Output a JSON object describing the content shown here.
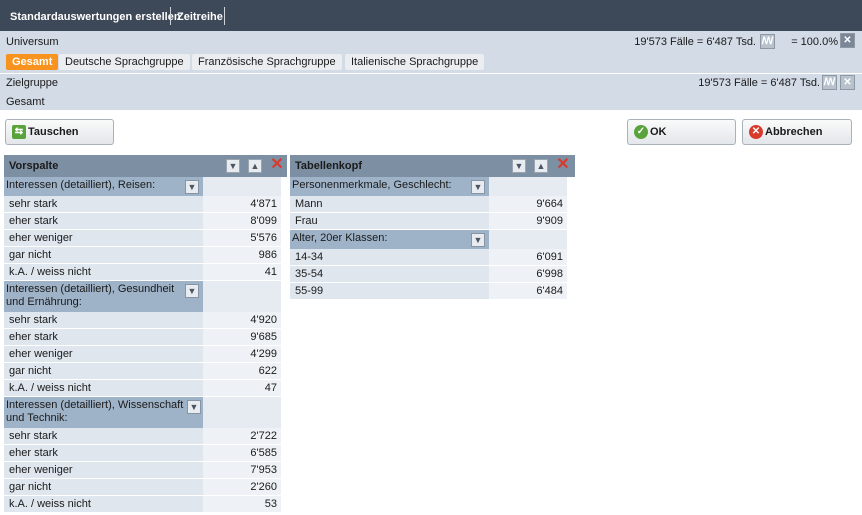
{
  "toolbar": {
    "tab1": "Standardauswertungen erstellen",
    "tab2": "Zeitreihe"
  },
  "universe": {
    "label": "Universum",
    "count": "19'573 Fälle = 6'487 Tsd.",
    "percent": "= 100.0%",
    "tabs": [
      "Gesamt",
      "Deutsche Sprachgruppe",
      "Französische Sprachgruppe",
      "Italienische Sprachgruppe"
    ],
    "active_tab": "Gesamt"
  },
  "target": {
    "label": "Zielgruppe",
    "count": "19'573 Fälle = 6'487 Tsd.",
    "value": "Gesamt"
  },
  "buttons": {
    "swap": "Tauschen",
    "ok": "OK",
    "cancel": "Abbrechen"
  },
  "vorspalte": {
    "title": "Vorspalte",
    "groups": [
      {
        "title": "Interessen (detailliert), Reisen:",
        "rows": [
          {
            "label": "sehr stark",
            "value": "4'871"
          },
          {
            "label": "eher stark",
            "value": "8'099"
          },
          {
            "label": "eher weniger",
            "value": "5'576"
          },
          {
            "label": "gar nicht",
            "value": "986"
          },
          {
            "label": "k.A. / weiss nicht",
            "value": "41"
          }
        ]
      },
      {
        "title": "Interessen (detailliert), Gesundheit und Ernährung:",
        "rows": [
          {
            "label": "sehr stark",
            "value": "4'920"
          },
          {
            "label": "eher stark",
            "value": "9'685"
          },
          {
            "label": "eher weniger",
            "value": "4'299"
          },
          {
            "label": "gar nicht",
            "value": "622"
          },
          {
            "label": "k.A. / weiss nicht",
            "value": "47"
          }
        ]
      },
      {
        "title": "Interessen (detailliert), Wissenschaft und Technik:",
        "rows": [
          {
            "label": "sehr stark",
            "value": "2'722"
          },
          {
            "label": "eher stark",
            "value": "6'585"
          },
          {
            "label": "eher weniger",
            "value": "7'953"
          },
          {
            "label": "gar nicht",
            "value": "2'260"
          },
          {
            "label": "k.A. / weiss nicht",
            "value": "53"
          }
        ]
      }
    ]
  },
  "tabellenkopf": {
    "title": "Tabellenkopf",
    "groups": [
      {
        "title": "Personenmerkmale, Geschlecht:",
        "rows": [
          {
            "label": "Mann",
            "value": "9'664"
          },
          {
            "label": "Frau",
            "value": "9'909"
          }
        ]
      },
      {
        "title": "Alter, 20er Klassen:",
        "rows": [
          {
            "label": "14-34",
            "value": "6'091"
          },
          {
            "label": "35-54",
            "value": "6'998"
          },
          {
            "label": "55-99",
            "value": "6'484"
          }
        ]
      }
    ]
  }
}
